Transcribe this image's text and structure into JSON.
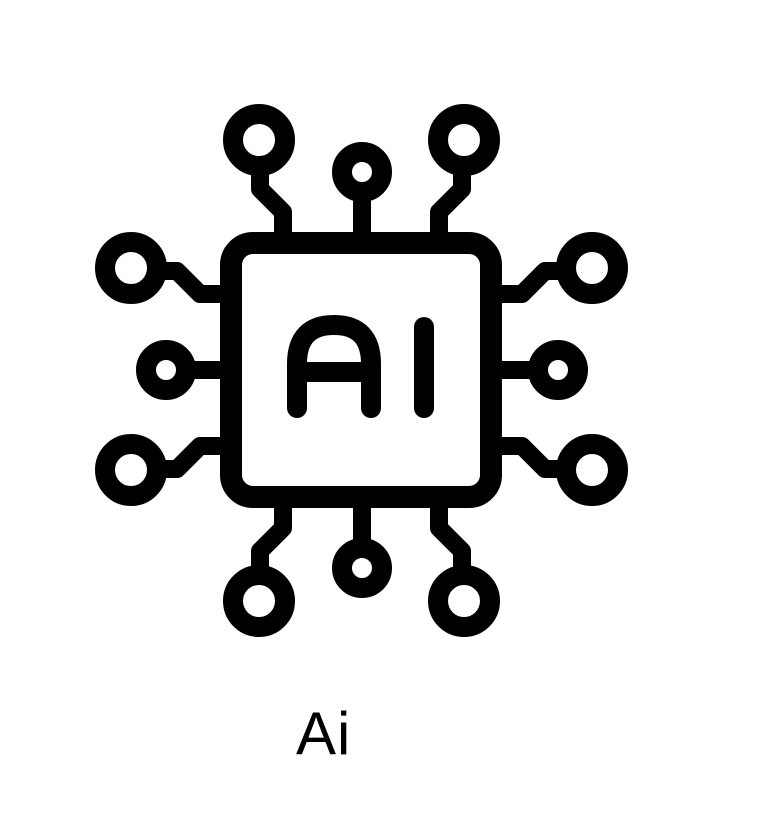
{
  "icon": {
    "name": "ai-chip-icon",
    "chip_label": "AI",
    "stroke_color": "#000000",
    "background_color": "#ffffff"
  },
  "caption": {
    "text": "Ai",
    "color": "#000000"
  }
}
